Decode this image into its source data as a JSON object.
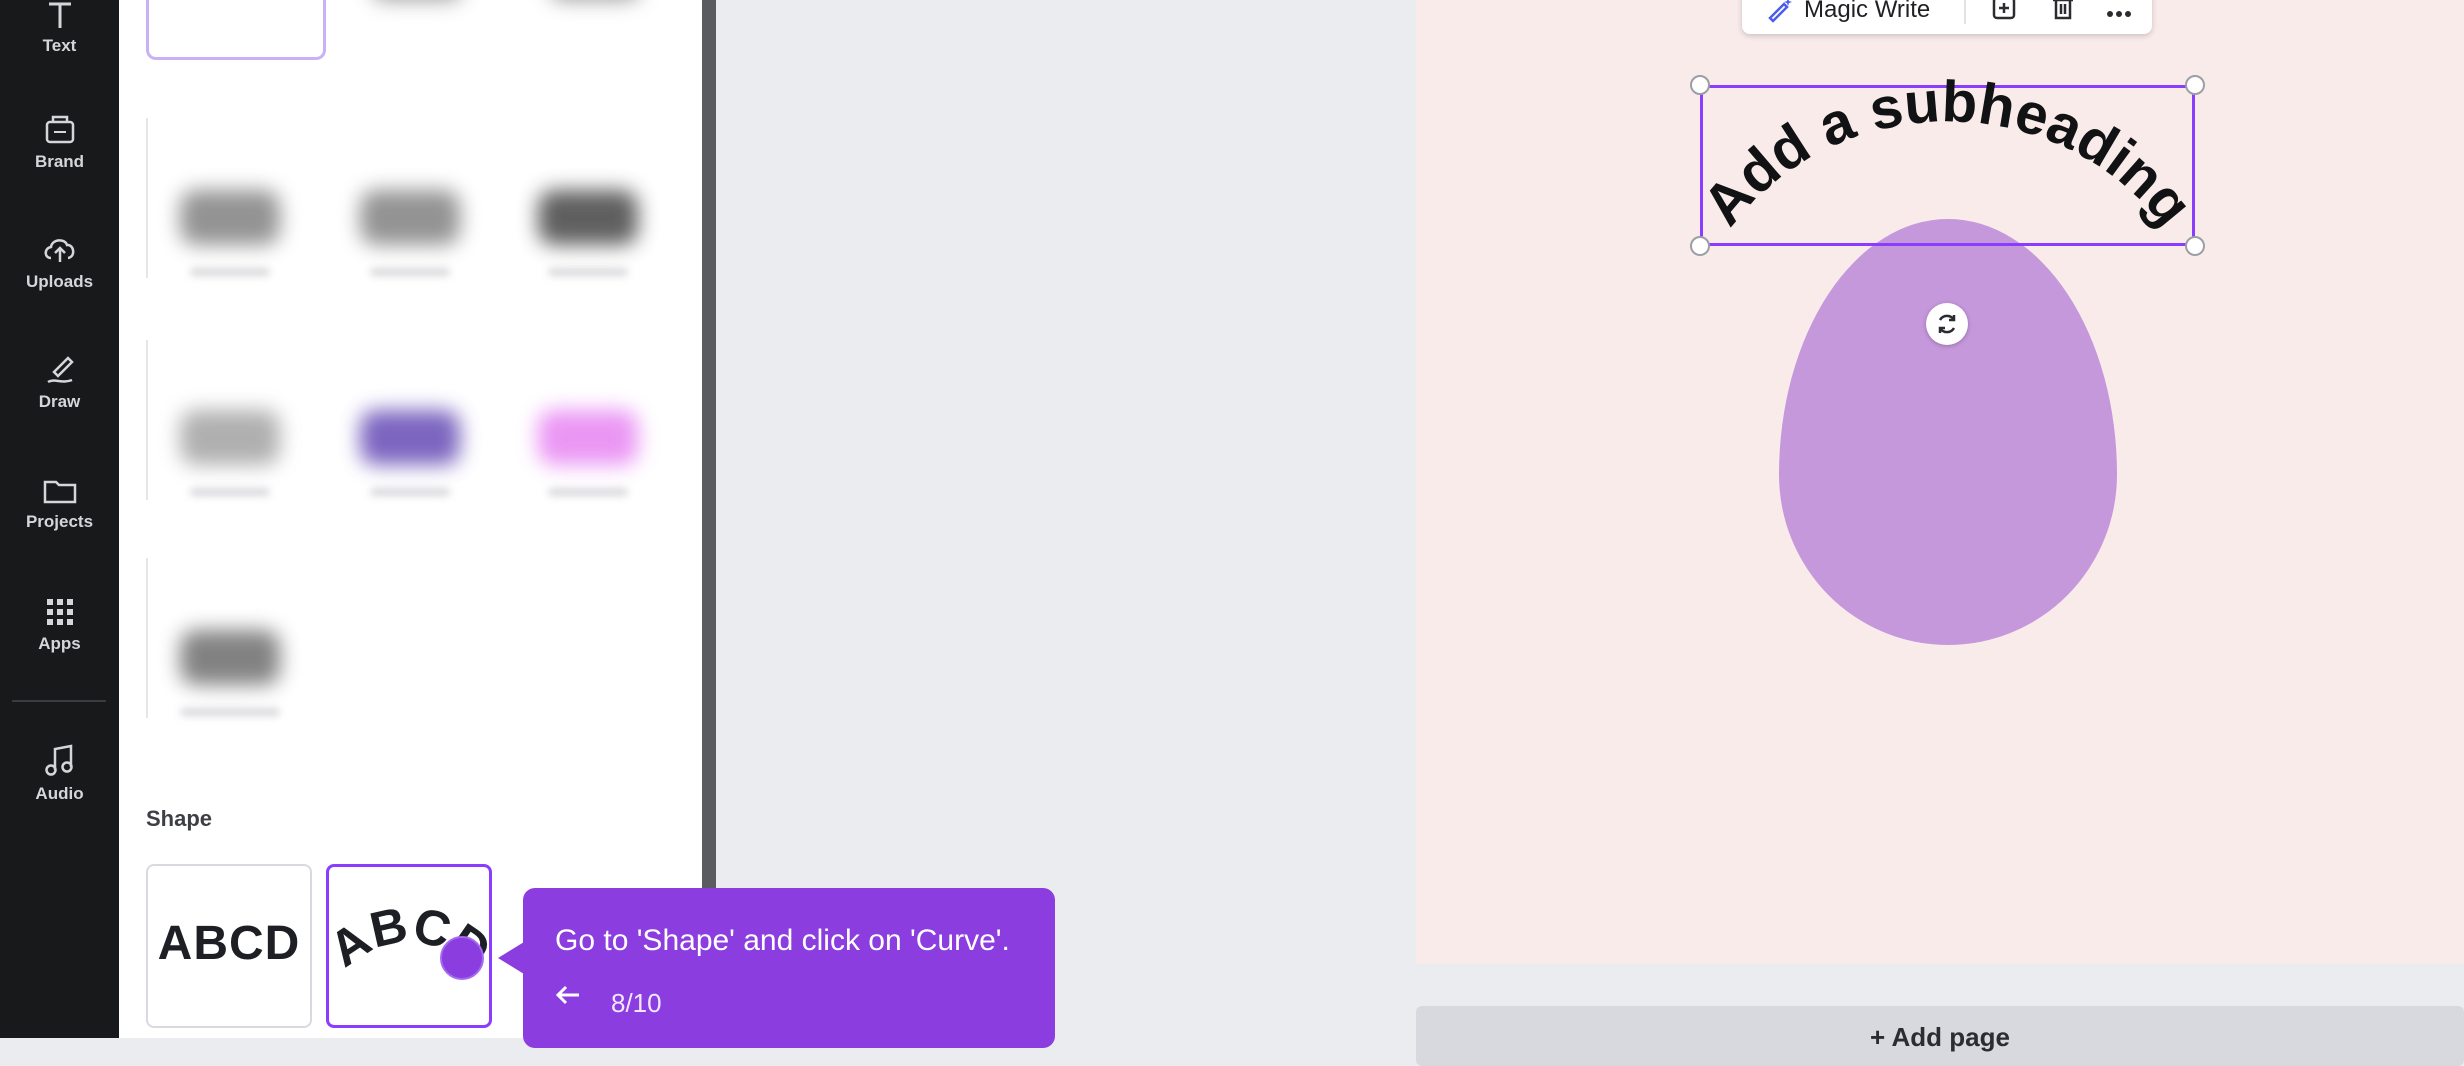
{
  "sidebar": {
    "items": [
      {
        "label": "Text",
        "icon": "text-icon"
      },
      {
        "label": "Brand",
        "icon": "brand-icon"
      },
      {
        "label": "Uploads",
        "icon": "cloud-upload-icon"
      },
      {
        "label": "Draw",
        "icon": "pen-icon"
      },
      {
        "label": "Projects",
        "icon": "folder-icon"
      },
      {
        "label": "Apps",
        "icon": "grid-icon"
      },
      {
        "label": "Audio",
        "icon": "music-note-icon"
      }
    ]
  },
  "panel": {
    "shape_heading": "Shape",
    "shape_options": [
      "ABCD",
      "ABCD"
    ],
    "selected_shape": "Curve",
    "effect_colors": [
      "#3b3b3b",
      "#3b3b3b",
      "#3b3b3b",
      "#3b3b3b",
      "#3b3b3b",
      "#2a2a2a",
      "#6f6f6f",
      "#5b3fb0",
      "#e26bf0",
      "#2f2f2f"
    ]
  },
  "tooltip": {
    "text": "Go to 'Shape' and click on 'Curve'.",
    "back_icon": "arrow-left-icon",
    "step": "8/10"
  },
  "canvas": {
    "toolbar_label": "Magic Write",
    "curved_text": "Add a subheading",
    "egg_color": "#c597db",
    "add_page_label": "+ Add page"
  },
  "colors": {
    "accent": "#8b3dff",
    "tooltip": "#8b3ddf",
    "page_bg": "#f9ebea"
  }
}
